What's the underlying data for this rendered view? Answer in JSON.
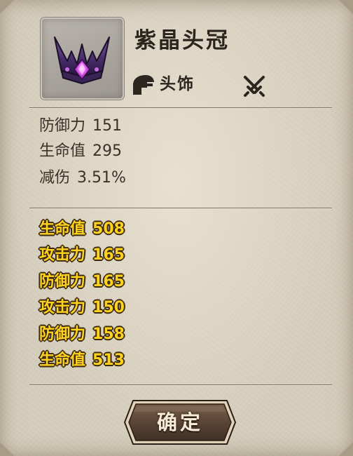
{
  "item": {
    "name": "紫晶头冠",
    "icon": "purple-crystal-crown-icon",
    "type_icon": "helmet-icon",
    "type": "头饰",
    "action_icon": "crossed-swords-icon"
  },
  "base_stats": [
    {
      "label": "防御力",
      "value": "151"
    },
    {
      "label": "生命值",
      "value": "295"
    },
    {
      "label": "减伤",
      "value": "3.51%"
    }
  ],
  "bonus_stats": [
    {
      "label": "生命值",
      "value": "508"
    },
    {
      "label": "攻击力",
      "value": "165"
    },
    {
      "label": "防御力",
      "value": "165"
    },
    {
      "label": "攻击力",
      "value": "150"
    },
    {
      "label": "防御力",
      "value": "158"
    },
    {
      "label": "生命值",
      "value": "513"
    }
  ],
  "confirm_button": {
    "label": "确定"
  },
  "colors": {
    "panel_bg": "#d6cebd",
    "bonus_text": "#ffd21e",
    "base_text": "#3a3229",
    "button_bg": "#5a4536"
  }
}
